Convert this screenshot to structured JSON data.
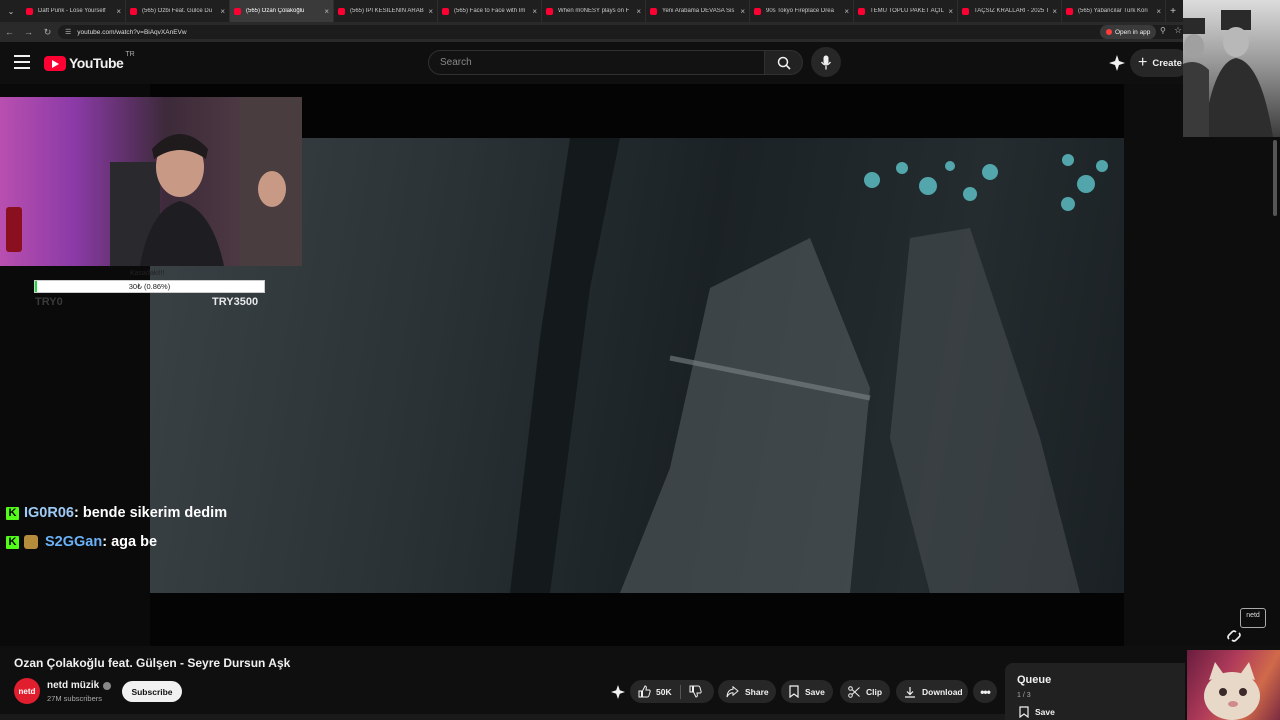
{
  "browser": {
    "tabs": [
      {
        "title": "Daft Punk - Lose Yourself",
        "active": false
      },
      {
        "title": "(565) Ozbi Feat. Gülce Du",
        "active": false
      },
      {
        "title": "(565) Ozan Çolakoğlu",
        "active": true
      },
      {
        "title": "(565) İPİ KESİLENİN ARAB",
        "active": false
      },
      {
        "title": "(565) Face to Face with Im",
        "active": false
      },
      {
        "title": "When m0NESY plays on F",
        "active": false
      },
      {
        "title": "Yeni Arabama DEVASA Sis",
        "active": false
      },
      {
        "title": "90s Tokyo Fireplace Drea",
        "active": false
      },
      {
        "title": "TEMU TOPLU PAKET AÇILI",
        "active": false
      },
      {
        "title": "TAÇSIZ KRALLARI - 2025 T",
        "active": false
      },
      {
        "title": "(565) Yabancılar Türk Kori",
        "active": false
      }
    ],
    "url": "youtube.com/watch?v=BiAqvXAnEVw",
    "open_in_app": "Open in app"
  },
  "header": {
    "logo_text": "YouTube",
    "region": "TR",
    "search_placeholder": "Search",
    "create_label": "Create"
  },
  "overlay": {
    "donation_label": "Kasadaki!!!",
    "progress_text": "30₺ (0.86%)",
    "progress_fraction": 0.0086,
    "min_label": "TRY0",
    "max_label": "TRY3500",
    "chat": [
      {
        "user": "IG0R06",
        "message": ": bende sikerim dedim"
      },
      {
        "user": "S2GGan",
        "message": ": aga be"
      }
    ],
    "watermark": "netd müzik"
  },
  "video": {
    "title": "Ozan Çolakoğlu feat. Gülşen - Seyre Dursun Aşk",
    "channel": "netd müzik",
    "subscribers": "27M subscribers",
    "subscribe_label": "Subscribe",
    "like_count": "50K",
    "share_label": "Share",
    "save_label": "Save",
    "clip_label": "Clip",
    "download_label": "Download",
    "channel_avatar_text": "netd"
  },
  "queue": {
    "title": "Queue",
    "count": "1 / 3",
    "save_label": "Save"
  },
  "colors": {
    "brand_red": "#ff0033",
    "progress_green": "#1ddc40",
    "kick_green": "#53fc18"
  }
}
